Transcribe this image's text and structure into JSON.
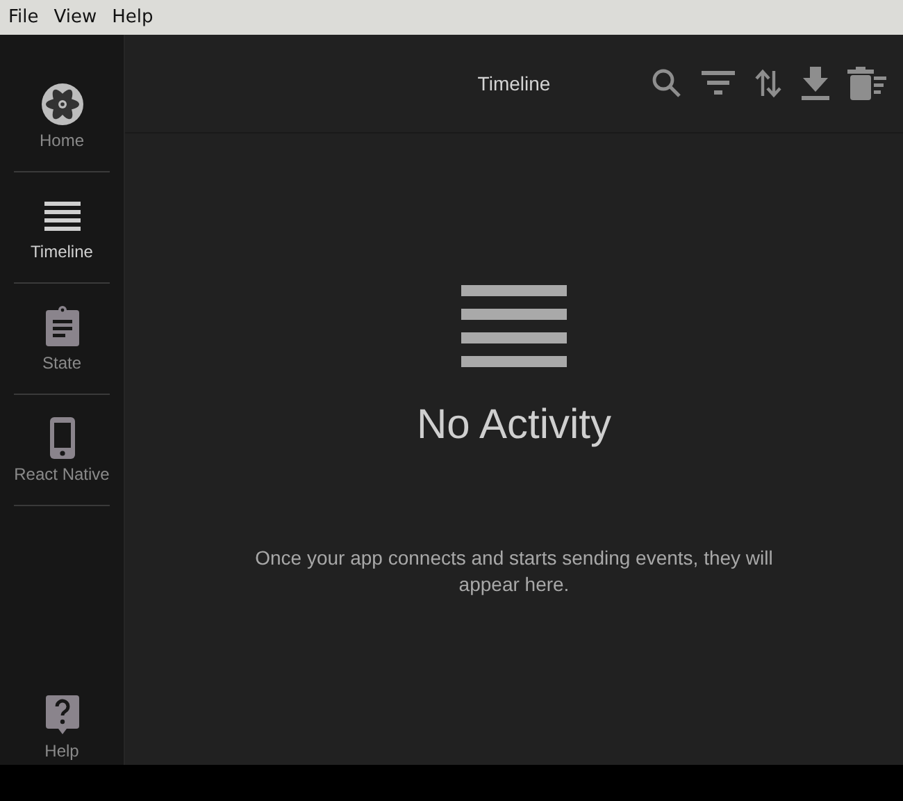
{
  "menu": [
    {
      "label": "File"
    },
    {
      "label": "View"
    },
    {
      "label": "Help"
    }
  ],
  "sidebar": {
    "items": [
      {
        "kind": "home",
        "label": "Home",
        "selected": false
      },
      {
        "kind": "timeline",
        "label": "Timeline",
        "selected": true
      },
      {
        "kind": "state",
        "label": "State",
        "selected": false
      },
      {
        "kind": "device",
        "label": "React Native",
        "selected": false
      }
    ],
    "footer": {
      "kind": "help",
      "label": "Help"
    }
  },
  "header": {
    "title": "Timeline",
    "actions": [
      {
        "kind": "search"
      },
      {
        "kind": "filter"
      },
      {
        "kind": "sort"
      },
      {
        "kind": "download"
      },
      {
        "kind": "clear"
      }
    ]
  },
  "empty_state": {
    "title": "No Activity",
    "message": "Once your app connects and starts sending events, they will appear here."
  }
}
